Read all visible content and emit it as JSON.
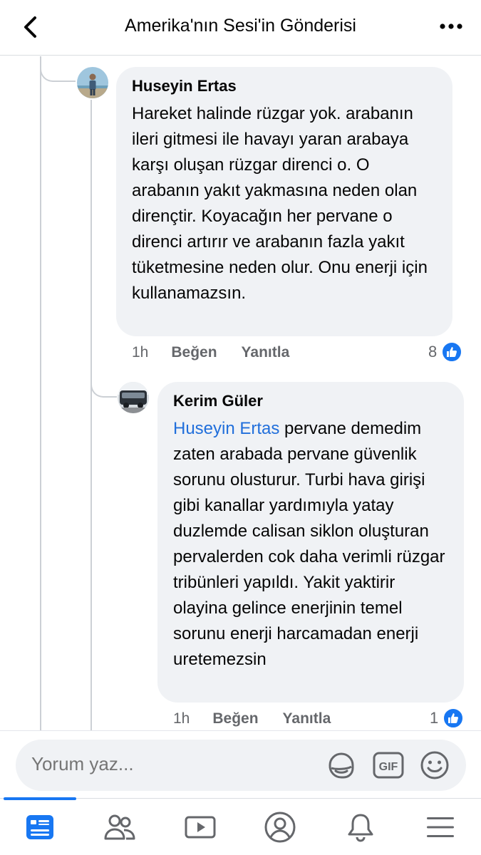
{
  "header": {
    "title": "Amerika'nın Sesi'in Gönderisi"
  },
  "comments": [
    {
      "author": "Huseyin Ertas",
      "text": "Hareket halinde rüzgar yok. arabanın ileri gitmesi ile havayı yaran arabaya karşı oluşan rüzgar direnci o. O arabanın yakıt yakmasına neden olan dirençtir. Koyacağın her pervane o direnci artırır ve arabanın fazla yakıt tüketmesine neden olur. Onu enerji için kullanamazsın.",
      "time": "1h",
      "like_label": "Beğen",
      "reply_label": "Yanıtla",
      "reactions": "8"
    },
    {
      "author": "Kerim Güler",
      "mention": "Huseyin Ertas",
      "text": " pervane demedim zaten arabada pervane güvenlik sorunu olusturur. Turbi hava girişi gibi kanallar yardımıyla yatay duzlemde calisan siklon oluşturan pervalerden cok daha verimli rüzgar tribünleri yapıldı. Yakit yaktirir olayina gelince enerjinin temel sorunu enerji harcamadan enerji uretemezsin",
      "time": "1h",
      "like_label": "Beğen",
      "reply_label": "Yanıtla",
      "reactions": "1"
    }
  ],
  "composer": {
    "placeholder": "Yorum yaz..."
  },
  "icons": {
    "back": "back-arrow-icon",
    "more": "more-icon",
    "sticker": "sticker-icon",
    "gif": "gif-icon",
    "emoji": "emoji-icon",
    "like": "like-icon"
  },
  "tabs": [
    "feed",
    "friends",
    "watch",
    "profile",
    "notifications",
    "menu"
  ],
  "colors": {
    "accent": "#1877f2",
    "mention": "#216fdb",
    "bubble": "#f0f2f5",
    "muted": "#65676b"
  }
}
